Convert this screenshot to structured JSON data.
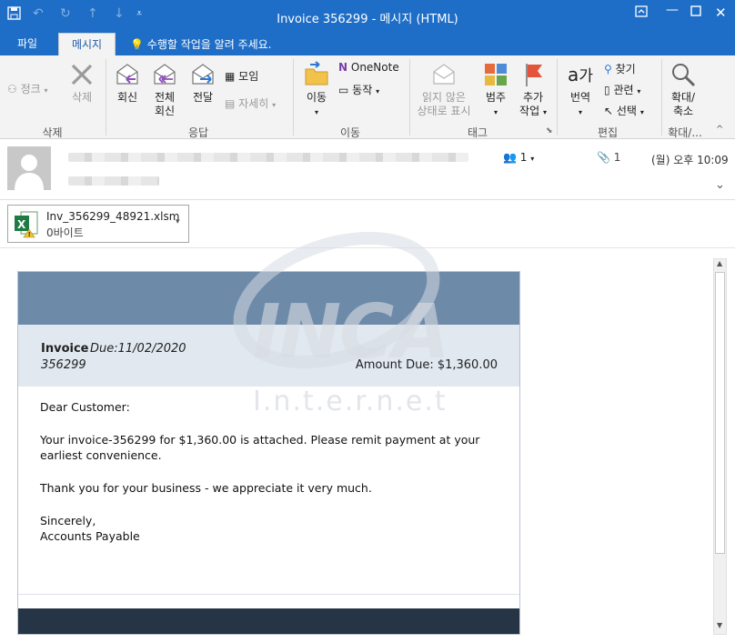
{
  "window": {
    "title": "Invoice 356299 - 메시지 (HTML)"
  },
  "tabs": [
    {
      "label": "파일"
    },
    {
      "label": "메시지"
    }
  ],
  "tell_me": "수행할 작업을 알려 주세요.",
  "ribbon": {
    "delete_group": {
      "label": "삭제",
      "junk": "정크",
      "delete": "삭제"
    },
    "respond_group": {
      "label": "응답",
      "reply": "회신",
      "reply_all_1": "전체",
      "reply_all_2": "회신",
      "forward": "전달",
      "meeting": "모임",
      "more": "자세히"
    },
    "move_group": {
      "label": "이동",
      "onenote": "OneNote",
      "move": "이동",
      "actions": "동작"
    },
    "tags_group": {
      "label": "태그",
      "mark_unread_1": "읽지 않은",
      "mark_unread_2": "상태로 표시",
      "categorize": "범주",
      "follow_up_1": "추가",
      "follow_up_2": "작업"
    },
    "editing_group": {
      "label": "편집",
      "translate": "번역",
      "find": "찾기",
      "related": "관련",
      "select": "선택"
    },
    "zoom_group": {
      "label": "확대/...",
      "zoom_1": "확대/",
      "zoom_2": "축소"
    }
  },
  "header": {
    "people_count": "1",
    "attachment_count": "1",
    "received": "(월) 오후 10:09"
  },
  "attachment": {
    "filename": "Inv_356299_48921.xlsm",
    "size": "0바이트"
  },
  "email": {
    "invoice_label": "Invoice",
    "due": "Due:11/02/2020",
    "invoice_number": "356299",
    "amount_due": "Amount Due: $1,360.00",
    "greeting": "Dear Customer:",
    "body_1a": "Your invoice-356299 for $1,360.00 is attached. Please remit payment at your",
    "body_1b": "earliest convenience.",
    "body_2": "Thank you for your business - we appreciate it very much.",
    "closing": "Sincerely,",
    "signature": "Accounts Payable"
  },
  "watermark": {
    "logo": "INCA",
    "sub": "I.n.t.e.r.n.e.t"
  },
  "colors": {
    "titlebar": "#1e6ec8",
    "card_header": "#6d8aa9",
    "card_band": "#e1e8f0",
    "card_footer": "#263545"
  }
}
